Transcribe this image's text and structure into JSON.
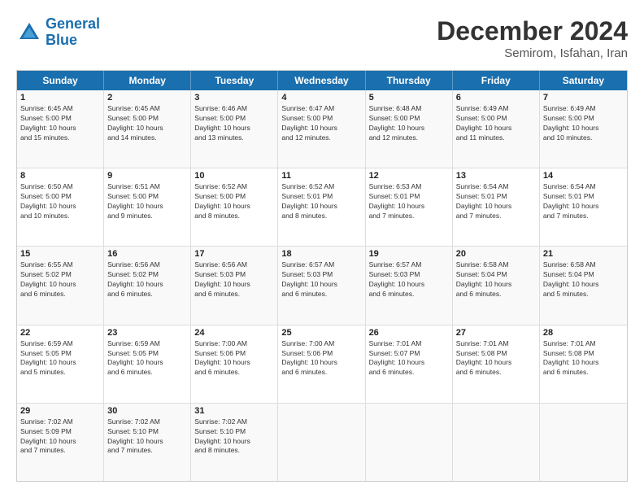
{
  "logo": {
    "text_general": "General",
    "text_blue": "Blue"
  },
  "header": {
    "month": "December 2024",
    "location": "Semirom, Isfahan, Iran"
  },
  "weekdays": [
    "Sunday",
    "Monday",
    "Tuesday",
    "Wednesday",
    "Thursday",
    "Friday",
    "Saturday"
  ],
  "rows": [
    [
      {
        "day": "1",
        "lines": [
          "Sunrise: 6:45 AM",
          "Sunset: 5:00 PM",
          "Daylight: 10 hours",
          "and 15 minutes."
        ]
      },
      {
        "day": "2",
        "lines": [
          "Sunrise: 6:45 AM",
          "Sunset: 5:00 PM",
          "Daylight: 10 hours",
          "and 14 minutes."
        ]
      },
      {
        "day": "3",
        "lines": [
          "Sunrise: 6:46 AM",
          "Sunset: 5:00 PM",
          "Daylight: 10 hours",
          "and 13 minutes."
        ]
      },
      {
        "day": "4",
        "lines": [
          "Sunrise: 6:47 AM",
          "Sunset: 5:00 PM",
          "Daylight: 10 hours",
          "and 12 minutes."
        ]
      },
      {
        "day": "5",
        "lines": [
          "Sunrise: 6:48 AM",
          "Sunset: 5:00 PM",
          "Daylight: 10 hours",
          "and 12 minutes."
        ]
      },
      {
        "day": "6",
        "lines": [
          "Sunrise: 6:49 AM",
          "Sunset: 5:00 PM",
          "Daylight: 10 hours",
          "and 11 minutes."
        ]
      },
      {
        "day": "7",
        "lines": [
          "Sunrise: 6:49 AM",
          "Sunset: 5:00 PM",
          "Daylight: 10 hours",
          "and 10 minutes."
        ]
      }
    ],
    [
      {
        "day": "8",
        "lines": [
          "Sunrise: 6:50 AM",
          "Sunset: 5:00 PM",
          "Daylight: 10 hours",
          "and 10 minutes."
        ]
      },
      {
        "day": "9",
        "lines": [
          "Sunrise: 6:51 AM",
          "Sunset: 5:00 PM",
          "Daylight: 10 hours",
          "and 9 minutes."
        ]
      },
      {
        "day": "10",
        "lines": [
          "Sunrise: 6:52 AM",
          "Sunset: 5:00 PM",
          "Daylight: 10 hours",
          "and 8 minutes."
        ]
      },
      {
        "day": "11",
        "lines": [
          "Sunrise: 6:52 AM",
          "Sunset: 5:01 PM",
          "Daylight: 10 hours",
          "and 8 minutes."
        ]
      },
      {
        "day": "12",
        "lines": [
          "Sunrise: 6:53 AM",
          "Sunset: 5:01 PM",
          "Daylight: 10 hours",
          "and 7 minutes."
        ]
      },
      {
        "day": "13",
        "lines": [
          "Sunrise: 6:54 AM",
          "Sunset: 5:01 PM",
          "Daylight: 10 hours",
          "and 7 minutes."
        ]
      },
      {
        "day": "14",
        "lines": [
          "Sunrise: 6:54 AM",
          "Sunset: 5:01 PM",
          "Daylight: 10 hours",
          "and 7 minutes."
        ]
      }
    ],
    [
      {
        "day": "15",
        "lines": [
          "Sunrise: 6:55 AM",
          "Sunset: 5:02 PM",
          "Daylight: 10 hours",
          "and 6 minutes."
        ]
      },
      {
        "day": "16",
        "lines": [
          "Sunrise: 6:56 AM",
          "Sunset: 5:02 PM",
          "Daylight: 10 hours",
          "and 6 minutes."
        ]
      },
      {
        "day": "17",
        "lines": [
          "Sunrise: 6:56 AM",
          "Sunset: 5:03 PM",
          "Daylight: 10 hours",
          "and 6 minutes."
        ]
      },
      {
        "day": "18",
        "lines": [
          "Sunrise: 6:57 AM",
          "Sunset: 5:03 PM",
          "Daylight: 10 hours",
          "and 6 minutes."
        ]
      },
      {
        "day": "19",
        "lines": [
          "Sunrise: 6:57 AM",
          "Sunset: 5:03 PM",
          "Daylight: 10 hours",
          "and 6 minutes."
        ]
      },
      {
        "day": "20",
        "lines": [
          "Sunrise: 6:58 AM",
          "Sunset: 5:04 PM",
          "Daylight: 10 hours",
          "and 6 minutes."
        ]
      },
      {
        "day": "21",
        "lines": [
          "Sunrise: 6:58 AM",
          "Sunset: 5:04 PM",
          "Daylight: 10 hours",
          "and 5 minutes."
        ]
      }
    ],
    [
      {
        "day": "22",
        "lines": [
          "Sunrise: 6:59 AM",
          "Sunset: 5:05 PM",
          "Daylight: 10 hours",
          "and 5 minutes."
        ]
      },
      {
        "day": "23",
        "lines": [
          "Sunrise: 6:59 AM",
          "Sunset: 5:05 PM",
          "Daylight: 10 hours",
          "and 6 minutes."
        ]
      },
      {
        "day": "24",
        "lines": [
          "Sunrise: 7:00 AM",
          "Sunset: 5:06 PM",
          "Daylight: 10 hours",
          "and 6 minutes."
        ]
      },
      {
        "day": "25",
        "lines": [
          "Sunrise: 7:00 AM",
          "Sunset: 5:06 PM",
          "Daylight: 10 hours",
          "and 6 minutes."
        ]
      },
      {
        "day": "26",
        "lines": [
          "Sunrise: 7:01 AM",
          "Sunset: 5:07 PM",
          "Daylight: 10 hours",
          "and 6 minutes."
        ]
      },
      {
        "day": "27",
        "lines": [
          "Sunrise: 7:01 AM",
          "Sunset: 5:08 PM",
          "Daylight: 10 hours",
          "and 6 minutes."
        ]
      },
      {
        "day": "28",
        "lines": [
          "Sunrise: 7:01 AM",
          "Sunset: 5:08 PM",
          "Daylight: 10 hours",
          "and 6 minutes."
        ]
      }
    ],
    [
      {
        "day": "29",
        "lines": [
          "Sunrise: 7:02 AM",
          "Sunset: 5:09 PM",
          "Daylight: 10 hours",
          "and 7 minutes."
        ]
      },
      {
        "day": "30",
        "lines": [
          "Sunrise: 7:02 AM",
          "Sunset: 5:10 PM",
          "Daylight: 10 hours",
          "and 7 minutes."
        ]
      },
      {
        "day": "31",
        "lines": [
          "Sunrise: 7:02 AM",
          "Sunset: 5:10 PM",
          "Daylight: 10 hours",
          "and 8 minutes."
        ]
      },
      {
        "day": "",
        "lines": []
      },
      {
        "day": "",
        "lines": []
      },
      {
        "day": "",
        "lines": []
      },
      {
        "day": "",
        "lines": []
      }
    ]
  ]
}
